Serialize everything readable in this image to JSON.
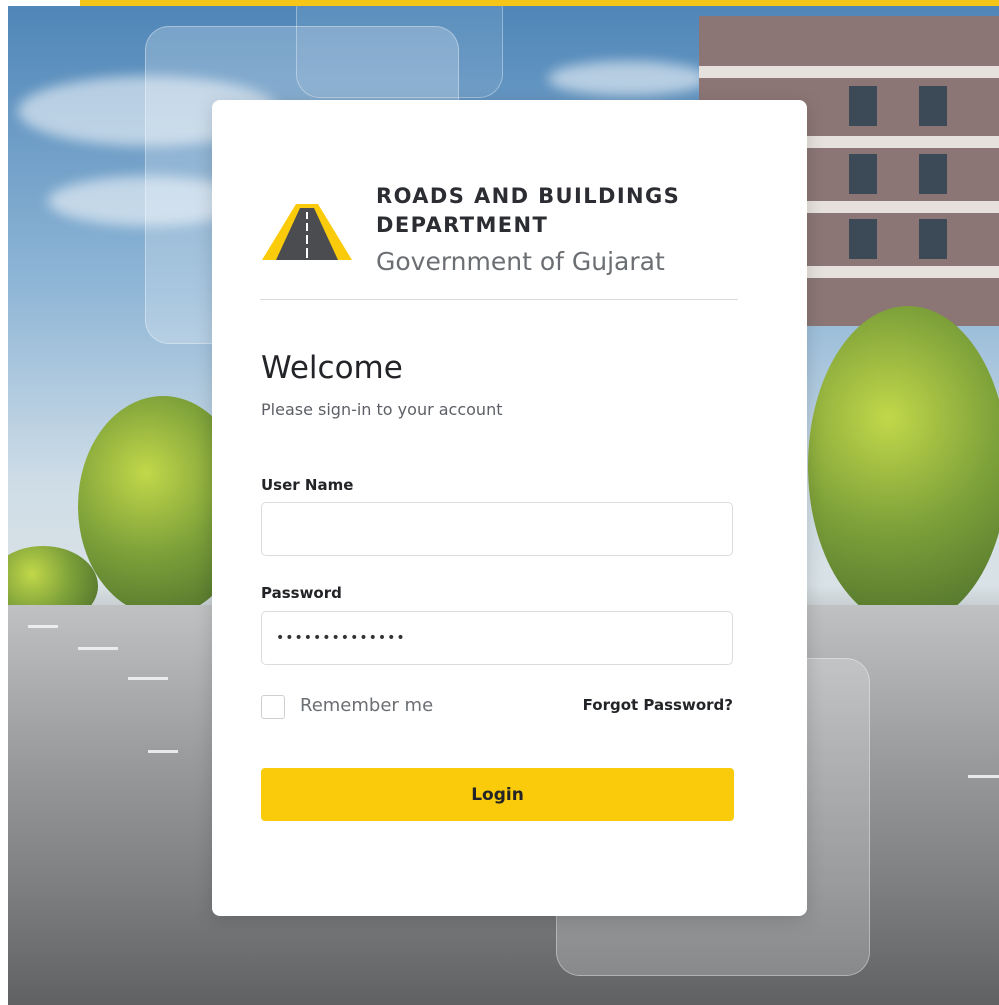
{
  "brand": {
    "line1": "ROADS AND BUILDINGS",
    "line2": "DEPARTMENT",
    "subtitle": "Government of Gujarat",
    "logo_icon": "road-triangle-icon"
  },
  "login": {
    "heading": "Welcome",
    "subheading": "Please sign-in to your account",
    "username": {
      "label": "User Name",
      "value": ""
    },
    "password": {
      "label": "Password",
      "value": "••••••••••••••"
    },
    "remember_label": "Remember me",
    "remember_checked": false,
    "forgot_label": "Forgot Password?",
    "submit_label": "Login"
  },
  "colors": {
    "accent": "#f9cb0a",
    "text_dark": "#222428",
    "text_muted": "#6b6e72"
  }
}
